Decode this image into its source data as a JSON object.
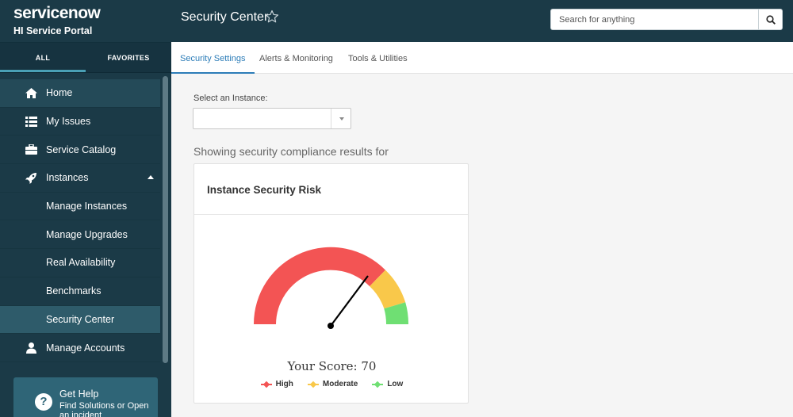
{
  "brand": {
    "logo_text_prefix": "service",
    "logo_text_suffix": "now",
    "portal_name": "HI Service Portal"
  },
  "sidebar": {
    "tabs": [
      {
        "label": "ALL",
        "active": true
      },
      {
        "label": "FAVORITES",
        "active": false
      }
    ],
    "items": [
      {
        "label": "Home",
        "icon": "home-icon"
      },
      {
        "label": "My Issues",
        "icon": "list-icon"
      },
      {
        "label": "Service Catalog",
        "icon": "briefcase-icon"
      },
      {
        "label": "Instances",
        "icon": "rocket-icon",
        "expanded": true
      },
      {
        "label": "Manage Instances"
      },
      {
        "label": "Manage Upgrades"
      },
      {
        "label": "Real Availability"
      },
      {
        "label": "Benchmarks"
      },
      {
        "label": "Security Center",
        "selected": true
      },
      {
        "label": "Manage Accounts",
        "icon": "user-icon"
      }
    ],
    "help": {
      "title": "Get Help",
      "subtitle": "Find Solutions or Open an incident"
    }
  },
  "header": {
    "title": "Security Center",
    "search_placeholder": "Search for anything"
  },
  "tabs": [
    {
      "label": "Security Settings",
      "active": true
    },
    {
      "label": "Alerts & Monitoring",
      "active": false
    },
    {
      "label": "Tools & Utilities",
      "active": false
    }
  ],
  "main": {
    "select_label": "Select an Instance:",
    "select_value": "",
    "showing_text": "Showing security compliance results for",
    "card_title": "Instance Security Risk",
    "score_text": "Your Score: 70",
    "score": 70,
    "legend": [
      {
        "label": "High",
        "color": "#f35454"
      },
      {
        "label": "Moderate",
        "color": "#f9c84a"
      },
      {
        "label": "Low",
        "color": "#6fdf73"
      }
    ]
  },
  "colors": {
    "sidebar_bg": "#1b3a47",
    "accent": "#2d7db8",
    "high": "#f35454",
    "moderate": "#f9c84a",
    "low": "#6fdf73"
  }
}
